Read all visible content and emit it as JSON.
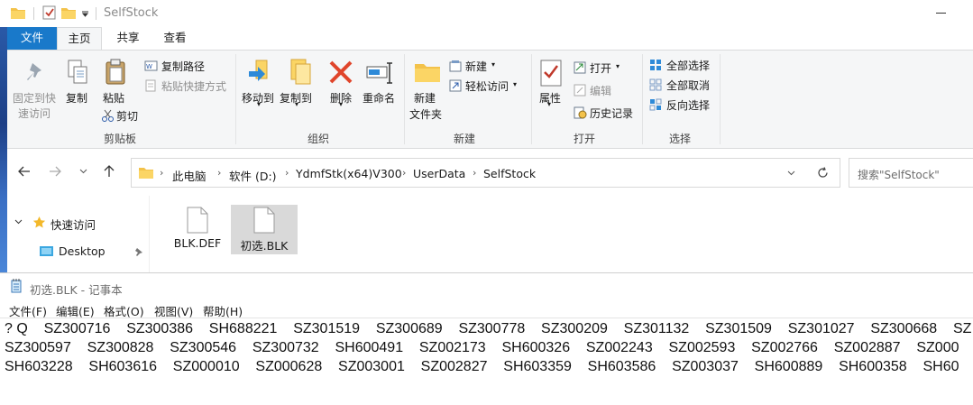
{
  "window": {
    "title": "SelfStock"
  },
  "tabs": {
    "file": "文件",
    "home": "主页",
    "share": "共享",
    "view": "查看"
  },
  "ribbon": {
    "clipboard": {
      "pin": "固定到快",
      "pin2": "速访问",
      "copy": "复制",
      "paste": "粘贴",
      "copy_path": "复制路径",
      "paste_shortcut": "粘贴快捷方式",
      "cut": "剪切",
      "label": "剪贴板"
    },
    "organize": {
      "move_to": "移动到",
      "copy_to": "复制到",
      "delete": "删除",
      "rename": "重命名",
      "label": "组织"
    },
    "new": {
      "new_folder": "新建",
      "new_folder2": "文件夹",
      "new_item": "新建",
      "easy_access": "轻松访问",
      "label": "新建"
    },
    "open": {
      "properties": "属性",
      "open": "打开",
      "edit": "编辑",
      "history": "历史记录",
      "label": "打开"
    },
    "select": {
      "select_all": "全部选择",
      "select_none": "全部取消",
      "invert": "反向选择",
      "label": "选择"
    }
  },
  "address": {
    "crumbs": [
      "此电脑",
      "软件 (D:)",
      "YdmfStk(x64)V300",
      "UserData",
      "SelfStock"
    ],
    "search_placeholder": "搜索\"SelfStock\""
  },
  "nav": {
    "quick_access": "快速访问",
    "desktop": "Desktop"
  },
  "files": [
    {
      "name": "BLK.DEF"
    },
    {
      "name": "初选.BLK"
    }
  ],
  "notepad": {
    "title": "初选.BLK - 记事本",
    "menu": [
      "文件(F)",
      "编辑(E)",
      "格式(O)",
      "视图(V)",
      "帮助(H)"
    ],
    "lines": [
      "? Q    SZ300716    SZ300386    SH688221    SZ301519    SZ300689    SZ300778    SZ300209    SZ301132    SZ301509    SZ301027    SZ300668    SZ",
      "SZ300597    SZ300828    SZ300546    SZ300732    SH600491    SZ002173    SH600326    SZ002243    SZ002593    SZ002766    SZ002887    SZ000",
      "SH603228    SH603616    SZ000010    SZ000628    SZ003001    SZ002827    SH603359    SH603586    SZ003037    SH600889    SH600358    SH60"
    ]
  },
  "colors": {
    "accent": "#1979ca",
    "selection": "#d9d9d9"
  }
}
